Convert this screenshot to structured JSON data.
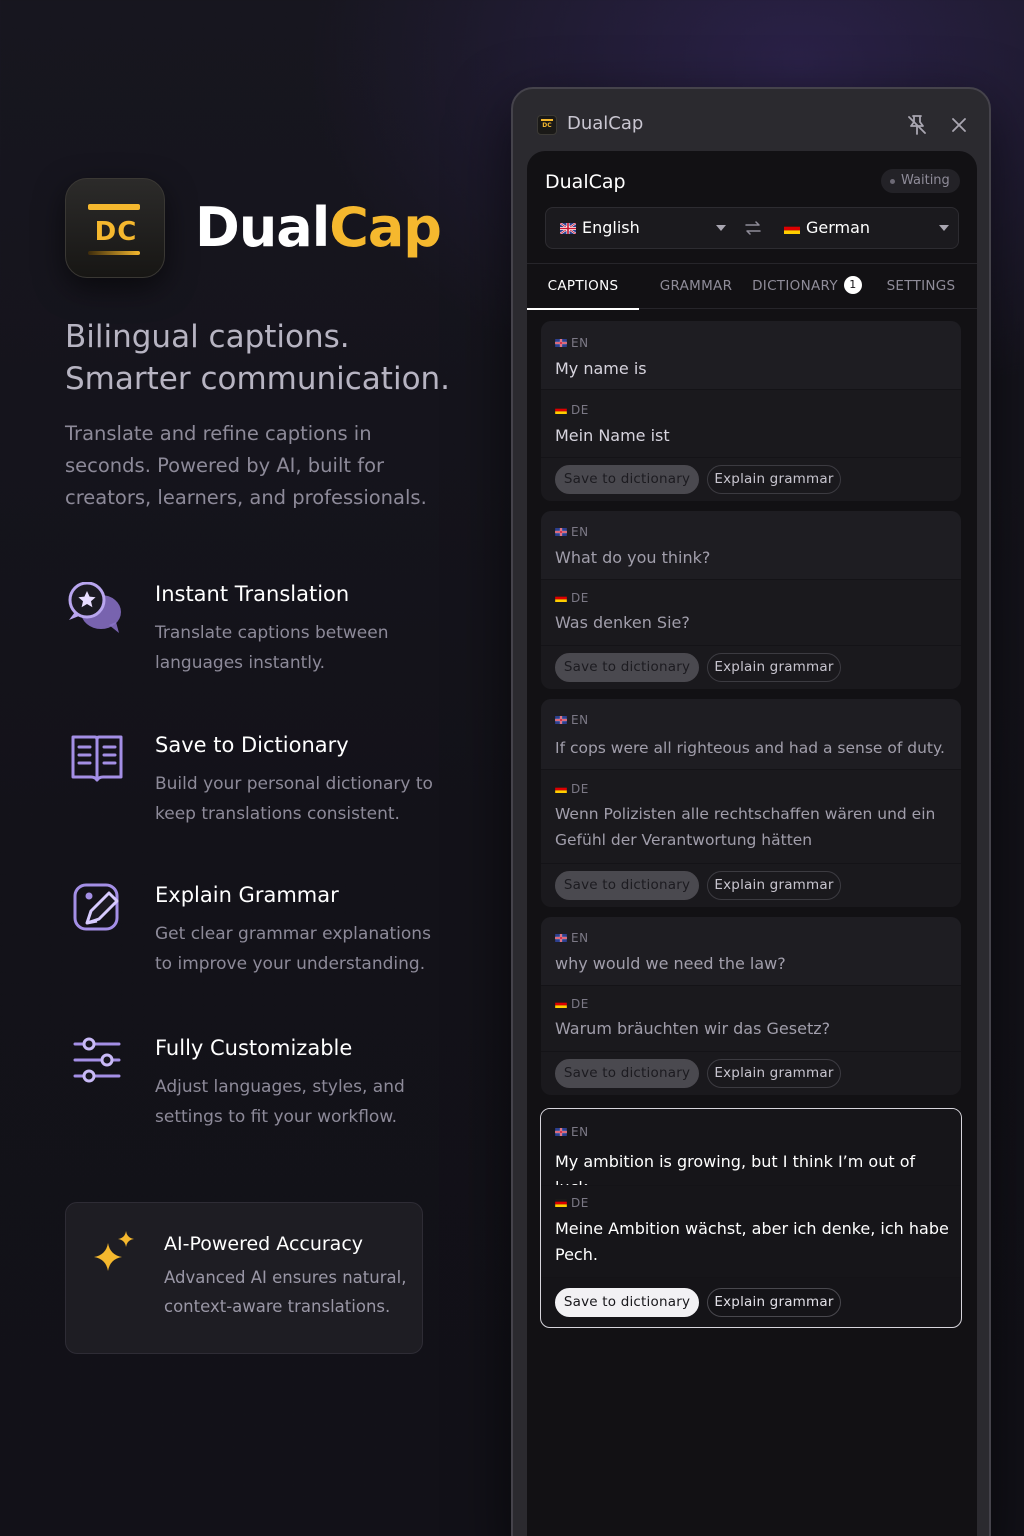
{
  "brand": {
    "name_part1": "Dual",
    "name_part2": "Cap",
    "icon_text": "DC",
    "accent_color": "#f5b82e"
  },
  "headline": {
    "line1": "Bilingual captions.",
    "line2": "Smarter communication."
  },
  "subhead": "Translate and refine captions in seconds. Powered by AI, built for creators, learners, and professionals.",
  "features": [
    {
      "icon": "chat-translate-icon",
      "title": "Instant Translation",
      "desc": "Translate captions between languages instantly."
    },
    {
      "icon": "book-icon",
      "title": "Save to Dictionary",
      "desc": "Build your personal dictionary to keep translations consistent."
    },
    {
      "icon": "edit-icon",
      "title": "Explain Grammar",
      "desc": "Get clear grammar explanations to improve your understanding."
    },
    {
      "icon": "sliders-icon",
      "title": "Fully Customizable",
      "desc": "Adjust languages, styles, and settings to fit your workflow."
    }
  ],
  "ai_card": {
    "icon": "sparkle-icon",
    "title": "AI-Powered Accuracy",
    "desc": "Advanced AI ensures natural, context-aware translations."
  },
  "window": {
    "title": "DualCap",
    "icon_text": "DC",
    "panel_title": "DualCap",
    "status": "Waiting",
    "source_lang": "English",
    "target_lang": "German",
    "tabs": [
      {
        "label": "CAPTIONS",
        "active": true
      },
      {
        "label": "GRAMMAR",
        "active": false
      },
      {
        "label": "DICTIONARY",
        "active": false,
        "count": "1"
      },
      {
        "label": "SETTINGS",
        "active": false
      }
    ],
    "tag_en": "EN",
    "tag_de": "DE",
    "save_label": "Save to dictionary",
    "explain_label": "Explain grammar"
  },
  "captions": [
    {
      "en": "My name is",
      "de": "Mein Name ist"
    },
    {
      "en": "What do you think?",
      "de": "Was denken Sie?"
    },
    {
      "en": "If cops were all righteous and had a sense of duty.",
      "de": "Wenn Polizisten alle rechtschaffen wären und ein Gefühl der Verantwortung hätten"
    },
    {
      "en": "why would we need the law?",
      "de": "Warum bräuchten wir das Gesetz?"
    },
    {
      "en": "My ambition is growing, but I think I’m out of luck.",
      "de": "Meine Ambition wächst, aber ich denke, ich habe Pech.",
      "selected": true
    }
  ]
}
